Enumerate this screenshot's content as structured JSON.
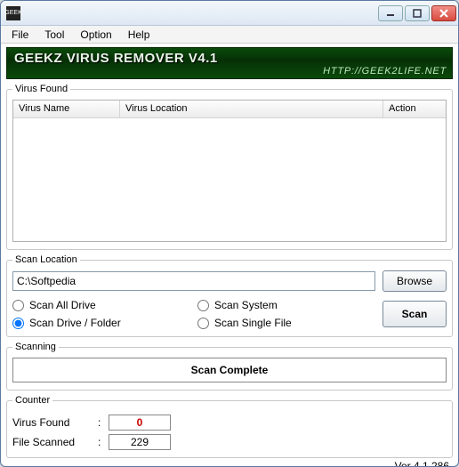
{
  "window": {
    "icon_text": "GEEK"
  },
  "menu": {
    "file": "File",
    "tool": "Tool",
    "option": "Option",
    "help": "Help"
  },
  "banner": {
    "title": "GEEKZ VIRUS REMOVER V4.1",
    "url": "HTTP://GEEK2LIFE.NET"
  },
  "virus_found": {
    "legend": "Virus Found",
    "columns": {
      "name": "Virus Name",
      "location": "Virus Location",
      "action": "Action"
    },
    "rows": []
  },
  "scan_location": {
    "legend": "Scan Location",
    "path": "C:\\Softpedia",
    "browse": "Browse",
    "scan": "Scan",
    "options": {
      "all_drive": "Scan All Drive",
      "system": "Scan System",
      "drive_folder": "Scan Drive / Folder",
      "single_file": "Scan Single File"
    },
    "selected": "drive_folder"
  },
  "scanning": {
    "legend": "Scanning",
    "status": "Scan Complete"
  },
  "counter": {
    "legend": "Counter",
    "virus_found_label": "Virus Found",
    "virus_found_value": "0",
    "file_scanned_label": "File Scanned",
    "file_scanned_value": "229"
  },
  "version": "Ver 4.1.286"
}
